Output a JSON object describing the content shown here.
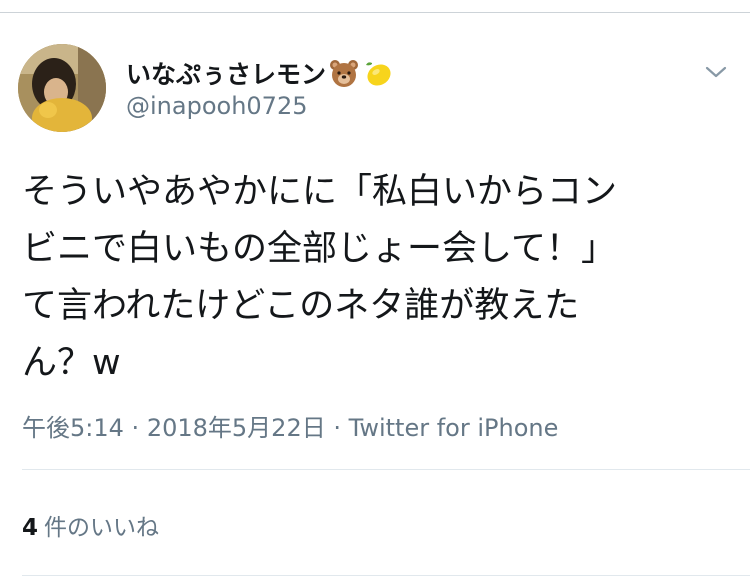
{
  "tweet": {
    "display_name": "いなぷぅさレモン",
    "name_emojis": [
      "bear-face-icon",
      "lemon-icon"
    ],
    "handle": "@inapooh0725",
    "text_lines": [
      "そういやあやかにに「私白いからコン",
      "ビニで白いもの全部じょー会して！」",
      "て言われたけどこのネタ誰が教えた",
      "ん？w"
    ],
    "time": "午後5:14",
    "date": "2018年5月22日",
    "source": "Twitter for iPhone",
    "separator": "·",
    "likes_count": "4",
    "likes_label": "件のいいね"
  },
  "colors": {
    "primary_text": "#14171a",
    "secondary_text": "#657786",
    "divider": "#e1e8ed"
  }
}
